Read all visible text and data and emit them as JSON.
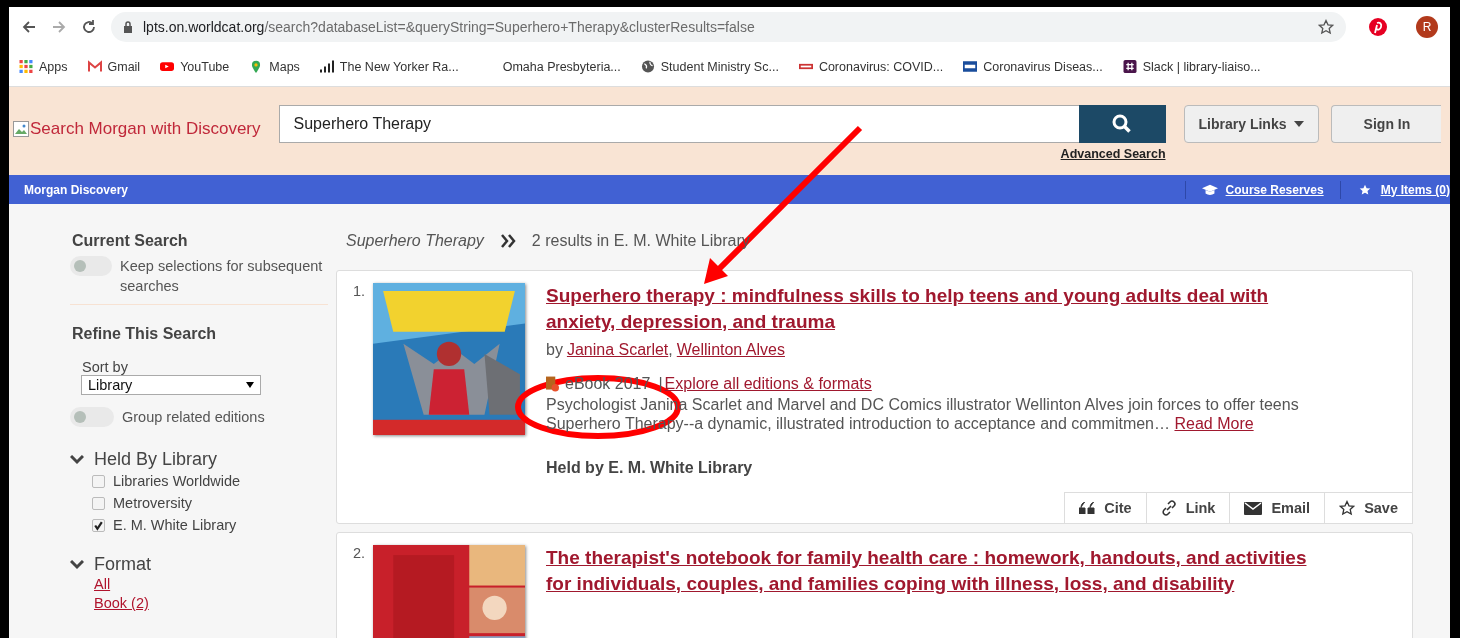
{
  "browser": {
    "url_host": "lpts.on.worldcat.org",
    "url_path": "/search?databaseList=&queryString=Superhero+Therapy&clusterResults=false",
    "profile_initial": "R",
    "bookmarks": [
      {
        "label": "Apps",
        "kind": "apps"
      },
      {
        "label": "Gmail",
        "kind": "gmail"
      },
      {
        "label": "YouTube",
        "kind": "youtube"
      },
      {
        "label": "Maps",
        "kind": "maps"
      },
      {
        "label": "The New Yorker Ra...",
        "kind": "bars"
      },
      {
        "label": "Omaha Presbyteria...",
        "kind": "none"
      },
      {
        "label": "Student Ministry Sc...",
        "kind": "globe"
      },
      {
        "label": "Coronavirus: COVID...",
        "kind": "news"
      },
      {
        "label": "Coronavirus Diseas...",
        "kind": "cdc"
      },
      {
        "label": "Slack | library-liaiso...",
        "kind": "slack"
      }
    ]
  },
  "header": {
    "logo_alt": "Search Morgan with Discovery",
    "search_value": "Superhero Therapy",
    "advanced_search": "Advanced Search",
    "library_links": "Library Links",
    "sign_in": "Sign In"
  },
  "nav": {
    "title": "Morgan Discovery",
    "links": [
      {
        "label": "Course Reserves",
        "kind": "cap"
      },
      {
        "label": "My Items (0)",
        "kind": "star"
      }
    ]
  },
  "sidebar": {
    "current_title": "Current Search",
    "keep_toggle": {
      "label": "Keep selections for subsequent searches",
      "on": false
    },
    "refine_title": "Refine This Search",
    "sort_label": "Sort by",
    "sort_value": "Library",
    "group_toggle": {
      "label": "Group related editions",
      "on": false
    },
    "held_by": {
      "title": "Held By Library",
      "expanded": true,
      "options": [
        {
          "label": "Libraries Worldwide",
          "checked": false
        },
        {
          "label": "Metroversity",
          "checked": false
        },
        {
          "label": "E. M. White Library",
          "checked": true
        }
      ]
    },
    "format": {
      "title": "Format",
      "expanded": true,
      "links": [
        "All",
        "Book  (2)"
      ]
    }
  },
  "results": {
    "query": "Superhero Therapy",
    "summary": "2 results in E. M. White Library",
    "items": [
      {
        "number": "1.",
        "title": "Superhero therapy : mindfulness skills to help teens and young adults deal with anxiety, depression, and trauma",
        "author_prefix": "by",
        "authors": [
          "Janina Scarlet",
          "Wellinton Alves"
        ],
        "author_separator": ",",
        "format": "eBook 2017",
        "format_separator": "|",
        "explore": "Explore all editions & formats",
        "description": "Psychologist Janina Scarlet and Marvel and DC Comics illustrator Wellinton Alves join forces to offer teens Superhero Therapy--a dynamic, illustrated introduction to acceptance and commitmen…",
        "read_more": "Read More",
        "held_by": "Held by E. M. White Library",
        "actions": [
          {
            "label": "Cite",
            "kind": "quote"
          },
          {
            "label": "Link",
            "kind": "link"
          },
          {
            "label": "Email",
            "kind": "mail"
          },
          {
            "label": "Save",
            "kind": "star"
          }
        ]
      },
      {
        "number": "2.",
        "title": "The therapist's notebook for family health care : homework, handouts, and activities for individuals, couples, and families coping with illness, loss, and disability"
      }
    ]
  }
}
